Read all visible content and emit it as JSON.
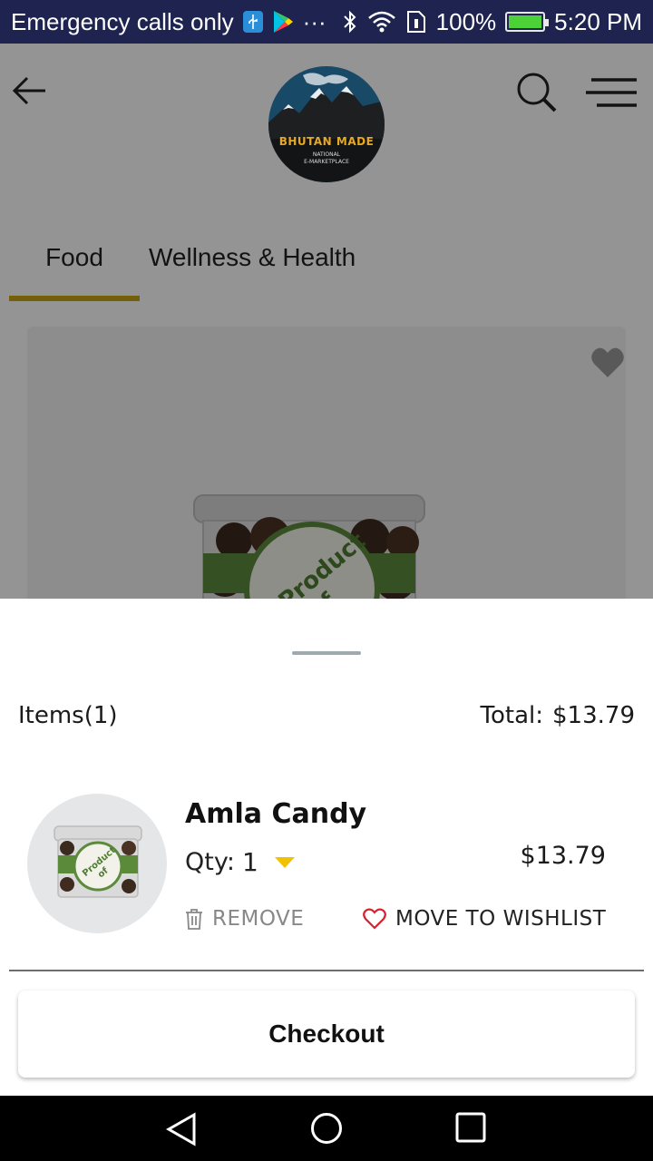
{
  "status_bar": {
    "carrier": "Emergency calls only",
    "overflow": "···",
    "battery": "100%",
    "time": "5:20 PM",
    "battery_level": 1.0
  },
  "app": {
    "logo": {
      "title": "BHUTAN MADE",
      "sub1": "NATIONAL",
      "sub2": "E-MARKETPLACE"
    },
    "tabs": [
      {
        "label": "Food",
        "selected": true
      },
      {
        "label": "Wellness & Health",
        "selected": false
      }
    ],
    "product_image_text": "Product of Bhutan"
  },
  "cart_sheet": {
    "items_label": "Items(1)",
    "total_label": "Total:",
    "total_value": "$13.79",
    "item": {
      "name": "Amla Candy",
      "qty_label": "Qty:",
      "qty_value": "1",
      "price": "$13.79",
      "remove_label": "REMOVE",
      "wishlist_label": "MOVE TO WISHLIST"
    },
    "checkout_label": "Checkout"
  },
  "colors": {
    "status_bar_bg": "#1e2350",
    "tab_indicator": "#c9a412",
    "qty_caret": "#f2c200",
    "wishlist_heart": "#d8202f"
  },
  "icons": [
    "usb-icon",
    "play-store-icon",
    "bluetooth-icon",
    "wifi-icon",
    "sim-icon",
    "battery-icon",
    "back-arrow-icon",
    "search-icon",
    "menu-icon",
    "heart-icon",
    "trash-icon",
    "heart-outline-icon",
    "caret-down-icon",
    "nav-back-icon",
    "nav-home-icon",
    "nav-recent-icon"
  ]
}
